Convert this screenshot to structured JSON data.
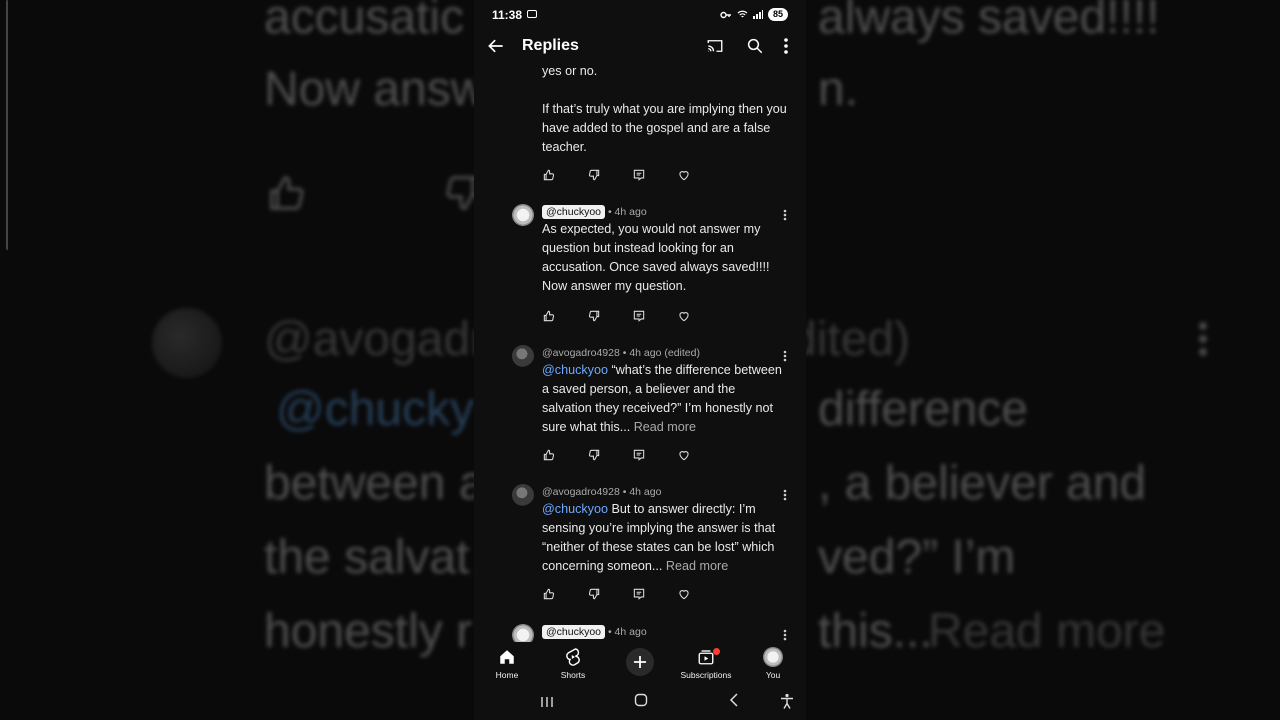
{
  "background": {
    "lines": [
      "accusatic",
      "always saved!!!!",
      "Now answ",
      "n.",
      "@avogadro",
      "dited)",
      "@chucky",
      "difference",
      "between a",
      ", a believer and",
      "the salvat",
      "ved?” I’m",
      "honestly r",
      "this...",
      "Read more"
    ]
  },
  "status_bar": {
    "time": "11:38",
    "battery": "85"
  },
  "header": {
    "title": "Replies",
    "icons": [
      "back-arrow-icon",
      "cast-icon",
      "search-icon",
      "more-vert-icon"
    ]
  },
  "top_comment": {
    "line1": "yes or no.",
    "line2": "If that’s truly what you are implying then you have added to the gospel and are a false teacher."
  },
  "replies": [
    {
      "author": "@chuckyoo",
      "time": "• 4h ago",
      "mention": "",
      "text": "As expected,  you would not answer my question but instead looking for an accusation. Once saved always saved!!!! Now answer my question.",
      "read_more": ""
    },
    {
      "author": "@avogadro4928",
      "time": "• 4h ago (edited)",
      "mention": " @chuckyoo",
      "text": " “what’s the difference between a saved person, a believer and the salvation they received?” I’m honestly not sure what this...",
      "read_more": " Read more"
    },
    {
      "author": "@avogadro4928",
      "time": "• 4h ago",
      "mention": " @chuckyoo",
      "text": " But to answer directly: I’m sensing you’re implying the answer is that “neither of these states can be lost” which concerning someon...",
      "read_more": " Read more"
    },
    {
      "author": "@chuckyoo",
      "time": "• 4h ago"
    }
  ],
  "bottom_nav": [
    {
      "label": "Home",
      "icon": "home-icon"
    },
    {
      "label": "Shorts",
      "icon": "shorts-icon"
    },
    {
      "label": "",
      "icon": "create-plus-icon"
    },
    {
      "label": "Subscriptions",
      "icon": "subscriptions-icon"
    },
    {
      "label": "You",
      "icon": "you-avatar"
    }
  ],
  "system_nav": [
    "recents-icon",
    "home-circle-icon",
    "back-chevron-icon",
    "accessibility-icon"
  ]
}
